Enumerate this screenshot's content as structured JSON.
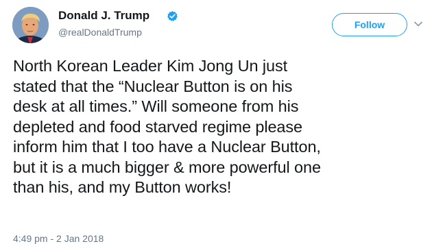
{
  "user": {
    "display_name": "Donald J. Trump",
    "handle": "@realDonaldTrump",
    "verified": true,
    "avatar_icon": "profile-photo"
  },
  "follow_button": {
    "label": "Follow"
  },
  "tweet": {
    "lines": [
      "North Korean Leader Kim Jong Un just",
      "stated that the “Nuclear Button is on his",
      "desk at all times.” Will someone from his",
      "depleted and food starved regime please",
      "inform him that I too have a Nuclear Button,",
      "but it is a much bigger & more powerful one",
      "than his, and my Button works!"
    ],
    "timestamp": "4:49 pm - 2 Jan 2018"
  },
  "colors": {
    "accent": "#1da1f2",
    "text": "#14171a",
    "secondary_text": "#657786",
    "background": "#ffffff"
  },
  "icons": {
    "verified": "verified-badge-icon",
    "menu": "chevron-down-icon"
  }
}
